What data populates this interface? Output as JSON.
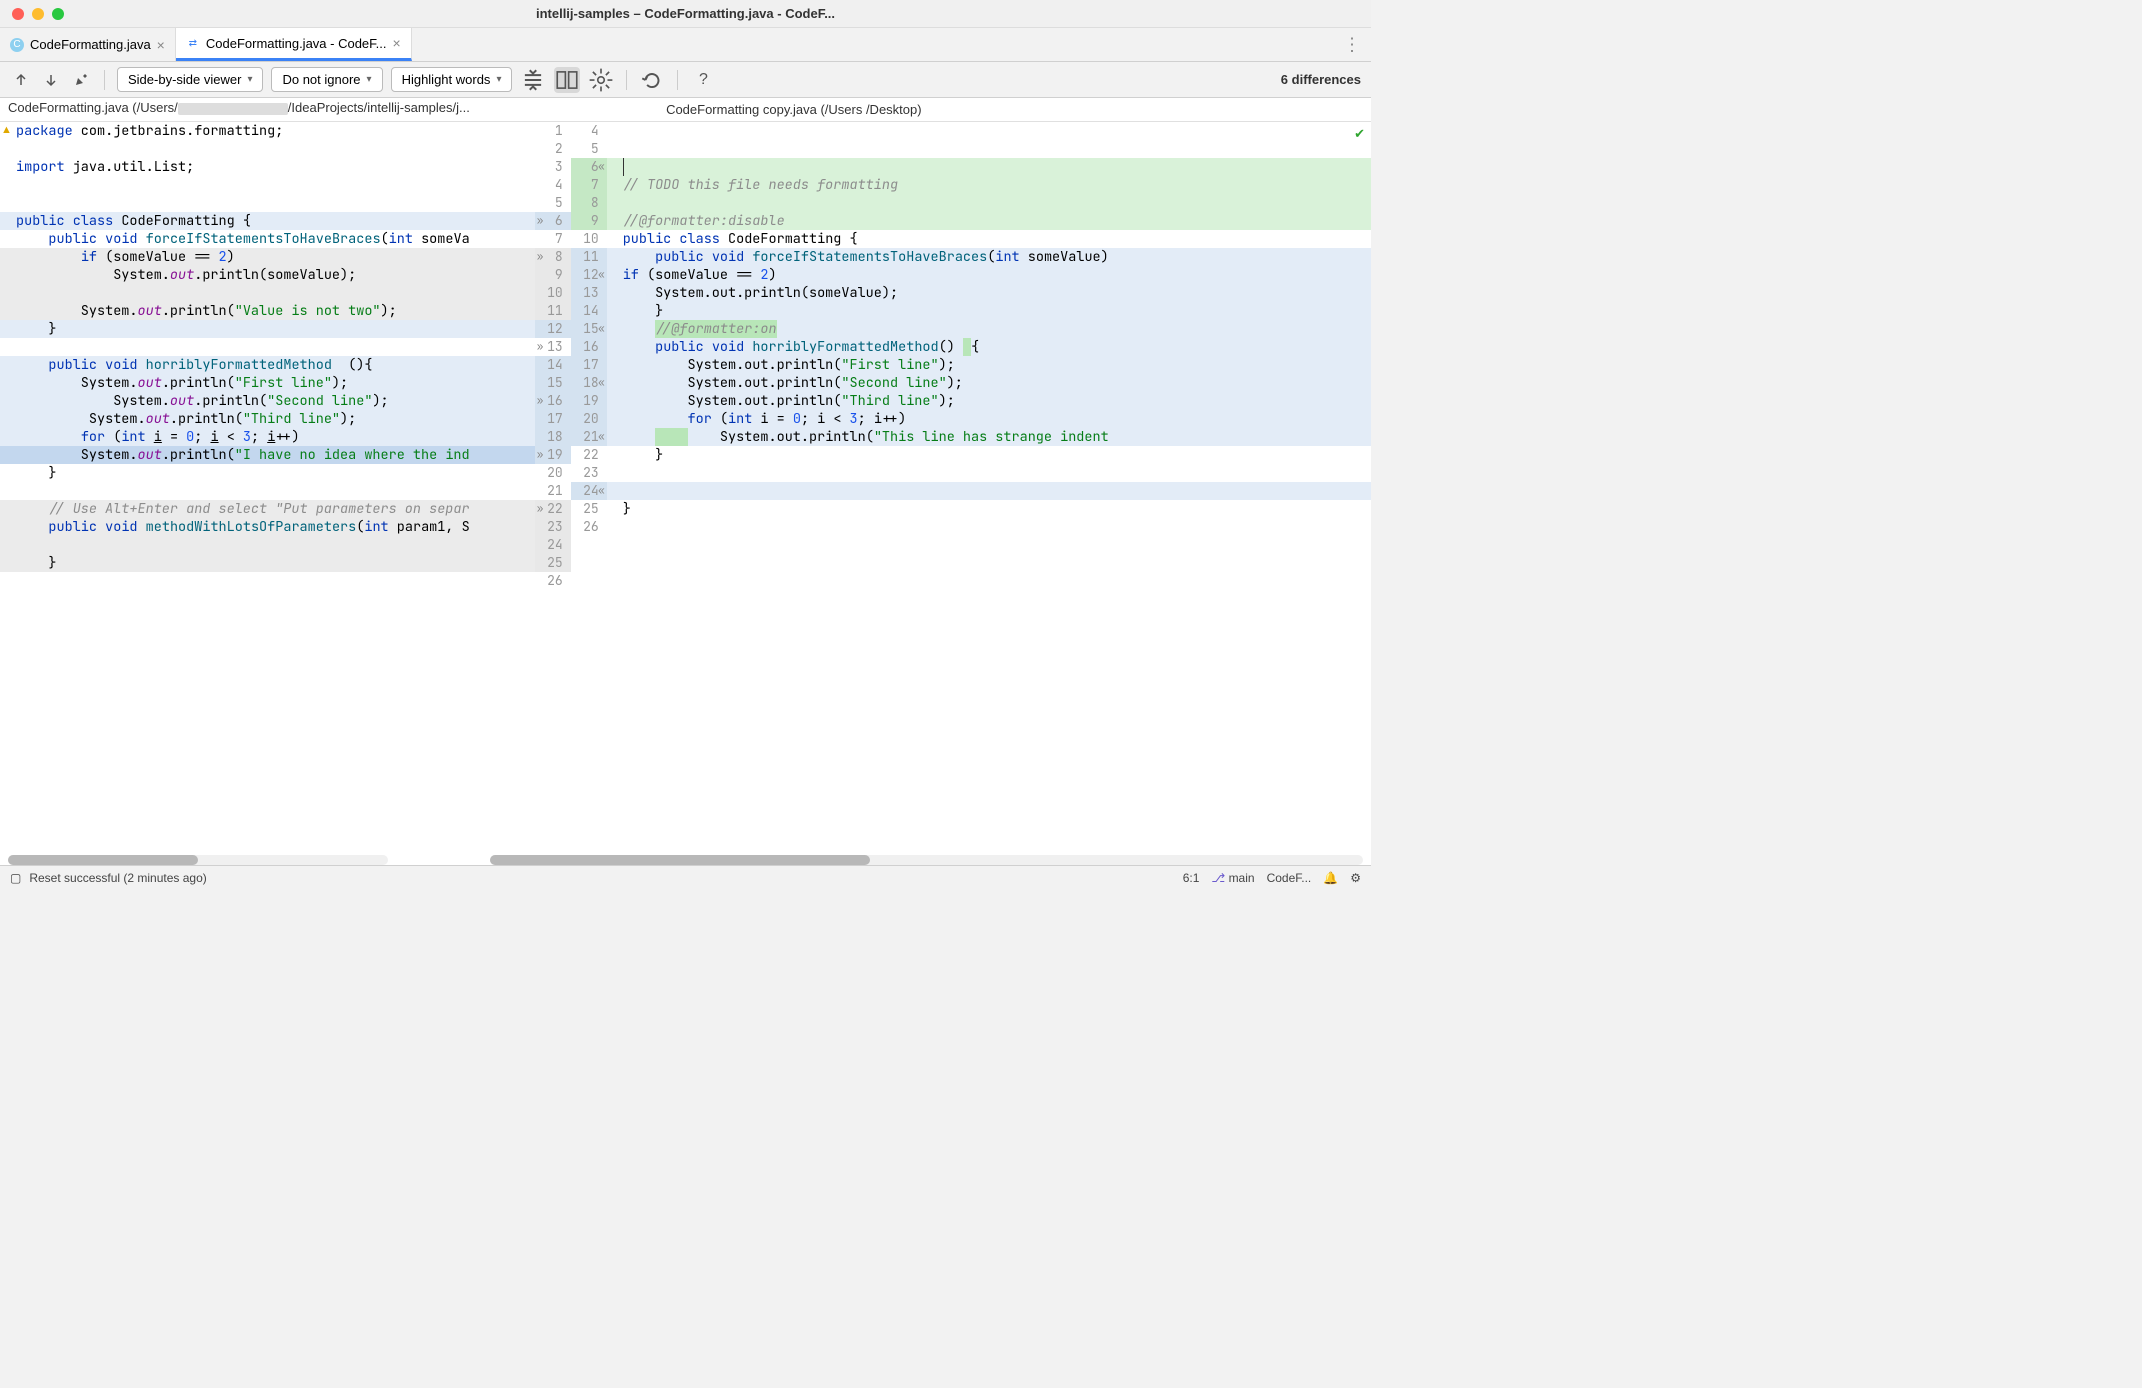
{
  "window": {
    "title": "intellij-samples – CodeFormatting.java - CodeF..."
  },
  "tabs": [
    {
      "label": "CodeFormatting.java",
      "icon": "C",
      "icon_bg": "#8ed0f0"
    },
    {
      "label": "CodeFormatting.java - CodeF...",
      "icon": "⇄",
      "icon_bg": "#5aa0e0"
    }
  ],
  "toolbar": {
    "viewer_mode": "Side-by-side viewer",
    "ignore_mode": "Do not ignore",
    "highlight_mode": "Highlight words",
    "diff_count": "6 differences"
  },
  "paths": {
    "left": "CodeFormatting.java (/Users/                          /IdeaProjects/intellij-samples/j...",
    "right": "CodeFormatting copy.java (/Users /Desktop)"
  },
  "left_code": [
    {
      "n": 1,
      "cls": "",
      "html": "<span class='kw'>package</span> com.jetbrains.formatting;"
    },
    {
      "n": 2,
      "cls": "",
      "html": ""
    },
    {
      "n": 3,
      "cls": "",
      "html": "<span class='kw'>import</span> java.util.List;"
    },
    {
      "n": 4,
      "cls": "",
      "html": ""
    },
    {
      "n": 5,
      "cls": "",
      "html": ""
    },
    {
      "n": 6,
      "cls": "bg-blue",
      "chev": "»",
      "html": "<span class='kw'>public</span> <span class='kw'>class</span> CodeFormatting {"
    },
    {
      "n": 7,
      "cls": "",
      "html": "    <span class='kw'>public</span> <span class='kw'>void</span> <span class='method'>forceIfStatementsToHaveBraces</span>(<span class='kw'>int</span> someVa"
    },
    {
      "n": 8,
      "cls": "bg-gray",
      "chev": "»",
      "html": "        <span class='kw'>if</span> (someValue == <span class='num'>2</span>)"
    },
    {
      "n": 9,
      "cls": "bg-gray",
      "html": "            System.<span class='field'>out</span>.println(someValue);"
    },
    {
      "n": 10,
      "cls": "bg-gray",
      "html": ""
    },
    {
      "n": 11,
      "cls": "bg-gray",
      "html": "        System.<span class='field'>out</span>.println(<span class='str'>\"Value is not two\"</span>);"
    },
    {
      "n": 12,
      "cls": "bg-blue",
      "html": "    }"
    },
    {
      "n": 13,
      "cls": "",
      "chev": "»",
      "html": ""
    },
    {
      "n": 14,
      "cls": "bg-blue",
      "html": "    <span class='kw'>public</span> <span class='kw'>void</span> <span class='method'>horriblyFormattedMethod</span>  (){"
    },
    {
      "n": 15,
      "cls": "bg-blue",
      "html": "        System.<span class='field'>out</span>.println(<span class='str'>\"First line\"</span>);"
    },
    {
      "n": 16,
      "cls": "bg-blue",
      "chev": "»",
      "html": "            System.<span class='field'>out</span>.println(<span class='str'>\"Second line\"</span>);"
    },
    {
      "n": 17,
      "cls": "bg-blue",
      "html": "         System.<span class='field'>out</span>.println(<span class='str'>\"Third line\"</span>);"
    },
    {
      "n": 18,
      "cls": "bg-blue",
      "html": "        <span class='kw'>for</span> (<span class='kw'>int</span> <u>i</u> = <span class='num'>0</span>; <u>i</u> &lt; <span class='num'>3</span>; <u>i</u>++)"
    },
    {
      "n": 19,
      "cls": "bg-blue-strong",
      "chev": "»",
      "html": "        System.<span class='field'>out</span>.println(<span class='str'>\"I have no idea where the ind</span>"
    },
    {
      "n": 20,
      "cls": "",
      "html": "    }"
    },
    {
      "n": 21,
      "cls": "",
      "html": ""
    },
    {
      "n": 22,
      "cls": "bg-gray",
      "chev": "»",
      "html": "    <span class='com'>// Use Alt+Enter and select \"Put parameters on separ</span>"
    },
    {
      "n": 23,
      "cls": "bg-gray",
      "html": "    <span class='kw'>public</span> <span class='kw'>void</span> <span class='method'>methodWithLotsOfParameters</span>(<span class='kw'>int</span> param1, S"
    },
    {
      "n": 24,
      "cls": "bg-gray",
      "html": ""
    },
    {
      "n": 25,
      "cls": "bg-gray",
      "html": "    }"
    },
    {
      "n": 26,
      "cls": "",
      "html": ""
    }
  ],
  "right_code": [
    {
      "n": 4,
      "cls": "",
      "html": ""
    },
    {
      "n": 5,
      "cls": "",
      "html": ""
    },
    {
      "n": 6,
      "cls": "bg-green",
      "chev": "«",
      "html": "<span style='border-left:1px solid #333;'>&nbsp;</span>"
    },
    {
      "n": 7,
      "cls": "bg-green",
      "html": "<span class='com'>// TODO this file needs formatting</span>"
    },
    {
      "n": 8,
      "cls": "bg-green",
      "html": ""
    },
    {
      "n": 9,
      "cls": "bg-green",
      "html": "<span class='com'>//@formatter:disable</span>"
    },
    {
      "n": 10,
      "cls": "",
      "html": "<span class='kw'>public</span> <span class='kw'>class</span> CodeFormatting {"
    },
    {
      "n": 11,
      "cls": "bg-blue",
      "html": "    <span class='kw'>public</span> <span class='kw'>void</span> <span class='method'>forceIfStatementsToHaveBraces</span>(<span class='kw'>int</span> someValue)"
    },
    {
      "n": 12,
      "cls": "bg-blue",
      "chev": "«",
      "html": "<span class='kw'>if</span> (someValue == <span class='num'>2</span>)"
    },
    {
      "n": 13,
      "cls": "bg-blue",
      "html": "    System.out.println(someValue);"
    },
    {
      "n": 14,
      "cls": "bg-blue",
      "html": "    }"
    },
    {
      "n": 15,
      "cls": "bg-blue",
      "chev": "«",
      "html": "    <span class='com' style='background:#b8e6b8;'>//@formatter:on</span>"
    },
    {
      "n": 16,
      "cls": "bg-blue",
      "html": "    <span class='kw'>public</span> <span class='kw'>void</span> <span class='method'>horriblyFormattedMethod</span>() <span style='background:#b8e6b8;'>&nbsp;</span>{"
    },
    {
      "n": 17,
      "cls": "bg-blue",
      "html": "        System.out.println(<span class='str'>\"First line\"</span>);"
    },
    {
      "n": 18,
      "cls": "bg-blue",
      "chev": "«",
      "html": "        System.out.println(<span class='str'>\"Second line\"</span>);"
    },
    {
      "n": 19,
      "cls": "bg-blue",
      "html": "        System.out.println(<span class='str'>\"Third line\"</span>);"
    },
    {
      "n": 20,
      "cls": "bg-blue",
      "html": "        <span class='kw'>for</span> (<span class='kw'>int</span> i = <span class='num'>0</span>; i &lt; <span class='num'>3</span>; i++)"
    },
    {
      "n": 21,
      "cls": "bg-blue",
      "chev": "«",
      "html": "    <span style='background:#b8e6b8;'>&nbsp;&nbsp;&nbsp;&nbsp;</span>    System.out.println(<span class='str'>\"This line has strange indent</span>"
    },
    {
      "n": 22,
      "cls": "",
      "html": "    }"
    },
    {
      "n": 23,
      "cls": "",
      "html": ""
    },
    {
      "n": 24,
      "cls": "bg-blue",
      "chev": "«",
      "html": ""
    },
    {
      "n": 25,
      "cls": "",
      "html": "}"
    },
    {
      "n": 26,
      "cls": "",
      "html": ""
    }
  ],
  "status": {
    "message": "Reset successful (2 minutes ago)",
    "cursor": "6:1",
    "branch": "main",
    "branch_label": "CodeF..."
  }
}
